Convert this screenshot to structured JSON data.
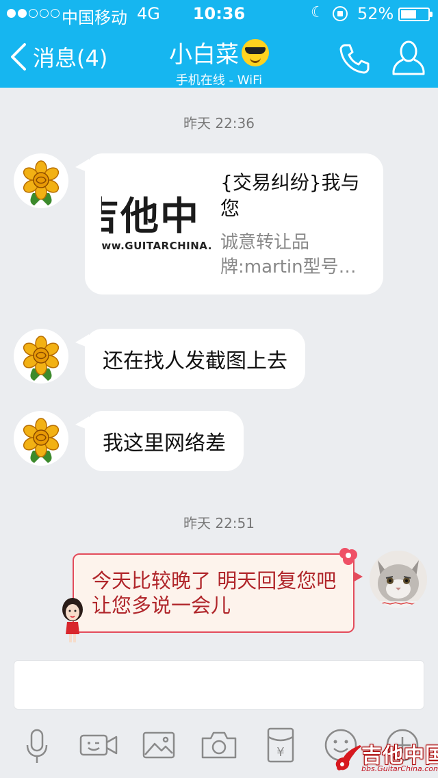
{
  "status_bar": {
    "carrier": "中国移动",
    "network": "4G",
    "time": "10:36",
    "battery": "52%",
    "battery_level": 0.52
  },
  "header": {
    "back_label": "消息(4)",
    "title": "小白菜",
    "subtitle": "手机在线 - WiFi"
  },
  "messages": {
    "timestamp_1": "昨天 22:36",
    "card": {
      "thumb_text": "吉他中",
      "thumb_url": "www.GUITARCHINA.",
      "title": "{交易纠纷}我与您",
      "description": "诚意转让品牌:martin型号…"
    },
    "msg_2": "还在找人发截图上去",
    "msg_3": "我这里网络差",
    "timestamp_2": "昨天 22:51",
    "msg_4": "今天比较晚了 明天回复您吧 让您多说一会儿"
  },
  "input": {
    "placeholder": ""
  },
  "watermark": {
    "text": "吉他中国",
    "url": "bbs.GuitarChina.com"
  },
  "colors": {
    "accent": "#16b6f0",
    "background": "#ebedf0",
    "bubble_red": "#e34b5b",
    "bubble_red_text": "#b0252a"
  }
}
